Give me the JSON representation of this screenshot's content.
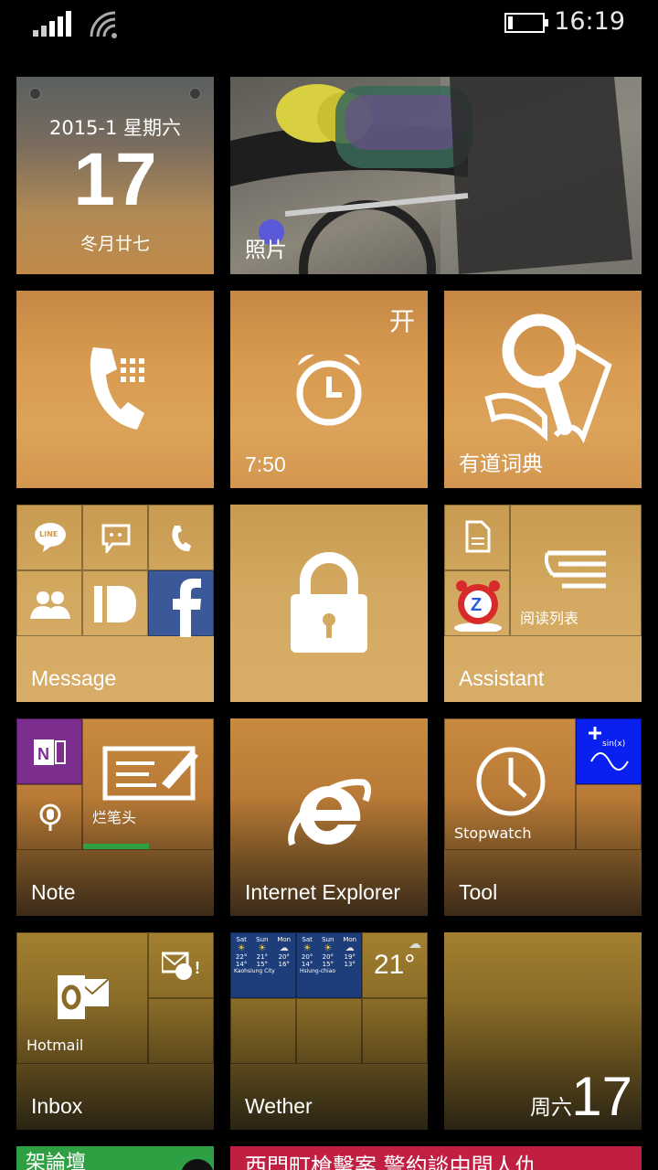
{
  "status_bar": {
    "time": "16:19",
    "signal_icon": "signal-bars-icon",
    "wifi_icon": "wifi-icon",
    "battery_icon": "battery-low-icon",
    "battery_level": 0.1
  },
  "tiles": {
    "calendar": {
      "header": "2015-1  星期六",
      "day": "17",
      "lunar": "冬月廿七"
    },
    "photos": {
      "label": "照片"
    },
    "phone": {
      "icon": "phone-icon"
    },
    "alarm": {
      "state": "开",
      "time": "7:50",
      "icon": "alarm-clock-icon"
    },
    "dictionary": {
      "label": "有道词典",
      "icon": "magnifier-book-icon"
    },
    "message": {
      "label": "Message",
      "subtiles": [
        "LINE",
        "messaging-icon",
        "phone-small-icon",
        "people-icon",
        "id-icon",
        "facebook-icon"
      ],
      "line_text": "LINE"
    },
    "lock": {
      "icon": "lock-icon"
    },
    "assistant": {
      "label": "Assistant",
      "reading_list": "阅读列表"
    },
    "note": {
      "label": "Note",
      "sub_label": "烂笔头"
    },
    "ie": {
      "label": "Internet Explorer"
    },
    "tool": {
      "label": "Tool",
      "sub_label": "Stopwatch",
      "calc_text": "sin(x)"
    },
    "inbox": {
      "label": "Inbox",
      "sub_label": "Hotmail"
    },
    "weather": {
      "label": "Wether",
      "temp": "21°",
      "cities": [
        {
          "name": "Kaohsiung City",
          "days": [
            {
              "d": "Sat",
              "hi": "22°",
              "lo": "14°"
            },
            {
              "d": "Sun",
              "hi": "21°",
              "lo": "15°"
            },
            {
              "d": "Mon",
              "hi": "20°",
              "lo": "16°"
            }
          ]
        },
        {
          "name": "Hsiung-chiao",
          "days": [
            {
              "d": "Sat",
              "hi": "20°",
              "lo": "14°"
            },
            {
              "d": "Sun",
              "hi": "20°",
              "lo": "15°"
            },
            {
              "d": "Mon",
              "hi": "19°",
              "lo": "13°"
            }
          ]
        }
      ]
    },
    "date_tile": {
      "weekday": "周六",
      "day": "17"
    },
    "forum": {
      "label": "架論壇"
    },
    "news": {
      "headline": "西門町槍擊案 警約談中間人仇"
    }
  },
  "colors": {
    "onenote": "#7b2e8e",
    "facebook": "#3b5998",
    "calculator": "#0a20f0",
    "weather_panel": "#1d3e7a",
    "forum": "#2ea043",
    "news": "#c01f42"
  }
}
